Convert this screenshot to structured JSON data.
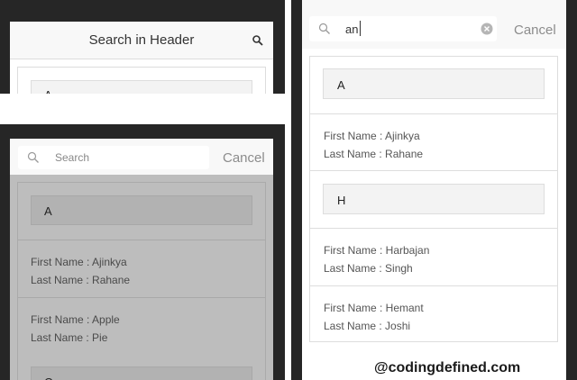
{
  "panel_top": {
    "title": "Search in Header",
    "list_divider": "A"
  },
  "panel_middle": {
    "search_placeholder": "Search",
    "cancel_label": "Cancel",
    "dividers": [
      "A",
      "C"
    ],
    "items": [
      {
        "first": "First Name : Ajinkya",
        "last": "Last Name : Rahane"
      },
      {
        "first": "First Name : Apple",
        "last": "Last Name : Pie"
      }
    ]
  },
  "panel_right": {
    "search_value": "an",
    "cancel_label": "Cancel",
    "dividers": [
      "A",
      "H"
    ],
    "items": [
      {
        "first": "First Name : Ajinkya",
        "last": "Last Name : Rahane"
      },
      {
        "first": "First Name : Harbajan",
        "last": "Last Name : Singh"
      },
      {
        "first": "First Name : Hemant",
        "last": "Last Name : Joshi"
      }
    ]
  },
  "watermark": "@codingdefined.com",
  "colors": {
    "background_dark": "#262626",
    "header": "#f8f8f8",
    "overlay": "#bdbdbd",
    "cancel_text": "#8c8c8c"
  }
}
